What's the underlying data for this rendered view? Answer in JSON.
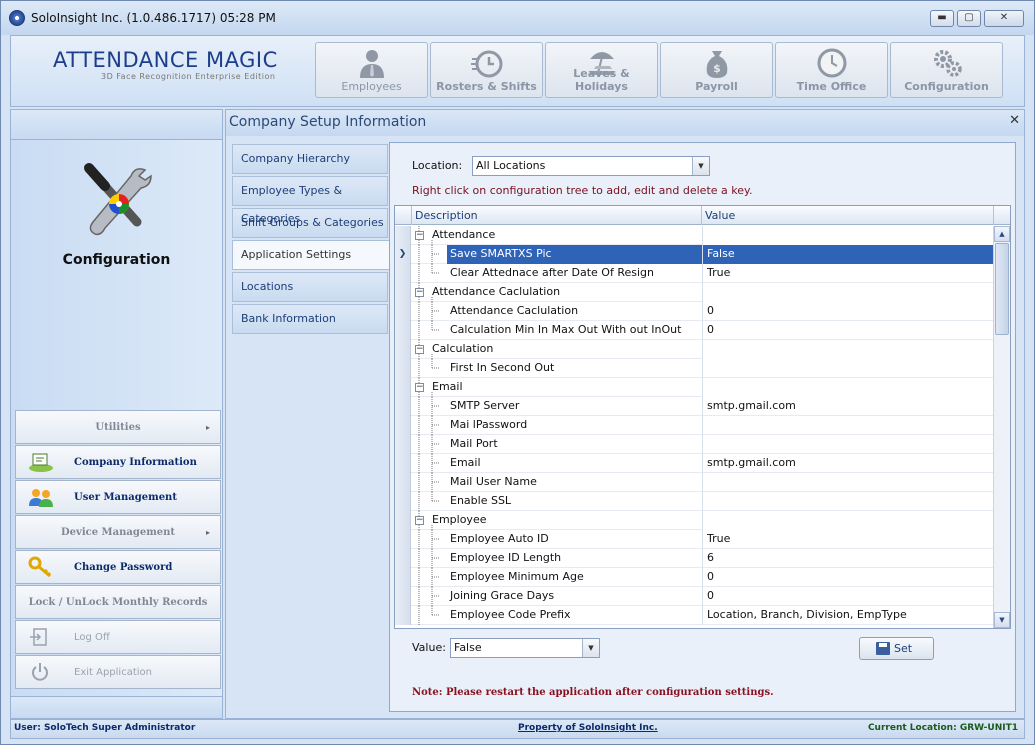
{
  "window": {
    "title": "SoloInsight Inc. (1.0.486.1717)   05:28 PM",
    "minimize_label": "▬",
    "maximize_label": "▢",
    "close_label": "✕"
  },
  "brand": {
    "title": "ATTENDANCE MAGIC",
    "subtitle": "3D Face Recognition Enterprise Edition"
  },
  "nav": {
    "tabs": [
      {
        "label": "Employees",
        "icon": "employee-icon"
      },
      {
        "label": "Rosters & Shifts",
        "icon": "stopwatch-icon"
      },
      {
        "label": "Leaves & Holidays",
        "icon": "beach-icon"
      },
      {
        "label": "Payroll",
        "icon": "money-bag-icon"
      },
      {
        "label": "Time Office",
        "icon": "clock-icon"
      },
      {
        "label": "Configuration",
        "icon": "gears-icon"
      }
    ]
  },
  "sidebar": {
    "section_title": "Configuration",
    "menu": [
      {
        "label": "Utilities",
        "type": "group",
        "has_arrow": true
      },
      {
        "label": "Company Information",
        "type": "item",
        "icon": "company-icon"
      },
      {
        "label": "User Management",
        "type": "item",
        "icon": "users-icon"
      },
      {
        "label": "Device Management",
        "type": "group",
        "has_arrow": true
      },
      {
        "label": "Change Password",
        "type": "item",
        "icon": "key-icon"
      },
      {
        "label": "Lock / UnLock Monthly Records",
        "type": "group"
      },
      {
        "label": "Log Off",
        "type": "disabled",
        "icon": "logoff-icon"
      },
      {
        "label": "Exit Application",
        "type": "disabled",
        "icon": "power-icon"
      }
    ]
  },
  "main": {
    "title": "Company Setup Information",
    "close_label": "✕",
    "subnav": [
      "Company Hierarchy",
      "Employee Types & Categories",
      "Shift Groups & Categories",
      "Application Settings",
      "Locations",
      "Bank Information"
    ],
    "active_subnav": "Application Settings",
    "location_label": "Location:",
    "location_value": "All Locations",
    "hint": "Right click on configuration tree to add, edit and delete a key.",
    "grid": {
      "col_description": "Description",
      "col_value": "Value",
      "rows": [
        {
          "desc": "Attendance",
          "value": "",
          "level": 0,
          "expander": "−"
        },
        {
          "desc": "Save SMARTXS Pic",
          "value": "False",
          "level": 1,
          "selected": true
        },
        {
          "desc": "Clear Attednace after Date Of Resign",
          "value": "True",
          "level": 1
        },
        {
          "desc": "Attendance Caclulation",
          "value": "",
          "level": 0,
          "expander": "−"
        },
        {
          "desc": "Attendance Caclulation",
          "value": "0",
          "level": 1
        },
        {
          "desc": "Calculation Min In Max Out With out InOut",
          "value": "0",
          "level": 1
        },
        {
          "desc": "Calculation",
          "value": "",
          "level": 0,
          "expander": "−"
        },
        {
          "desc": "First In Second Out",
          "value": "",
          "level": 1
        },
        {
          "desc": "Email",
          "value": "",
          "level": 0,
          "expander": "−"
        },
        {
          "desc": "SMTP Server",
          "value": "smtp.gmail.com",
          "level": 1
        },
        {
          "desc": "Mai lPassword",
          "value": "",
          "level": 1
        },
        {
          "desc": "Mail Port",
          "value": "",
          "level": 1
        },
        {
          "desc": "Email",
          "value": "smtp.gmail.com",
          "level": 1
        },
        {
          "desc": "Mail User Name",
          "value": "",
          "level": 1
        },
        {
          "desc": "Enable SSL",
          "value": "",
          "level": 1
        },
        {
          "desc": "Employee",
          "value": "",
          "level": 0,
          "expander": "−"
        },
        {
          "desc": "Employee Auto ID",
          "value": "True",
          "level": 1
        },
        {
          "desc": "Employee ID Length",
          "value": "6",
          "level": 1
        },
        {
          "desc": "Employee Minimum Age",
          "value": "0",
          "level": 1
        },
        {
          "desc": "Joining Grace Days",
          "value": "0",
          "level": 1
        },
        {
          "desc": "Employee Code Prefix",
          "value": "Location, Branch, Division, EmpType",
          "level": 1
        }
      ],
      "row_indicator": "❯"
    },
    "value_label": "Value:",
    "value_value": "False",
    "set_label": "Set",
    "note": "Note: Please restart the application after configuration settings."
  },
  "status": {
    "user": "User: SoloTech    Super Administrator",
    "property": "Property of SoloInsight Inc.",
    "location": "Current Location: GRW-UNIT1"
  },
  "colors": {
    "selection": "#2f63b8",
    "note": "#8a1020",
    "hint": "#7b1020"
  }
}
